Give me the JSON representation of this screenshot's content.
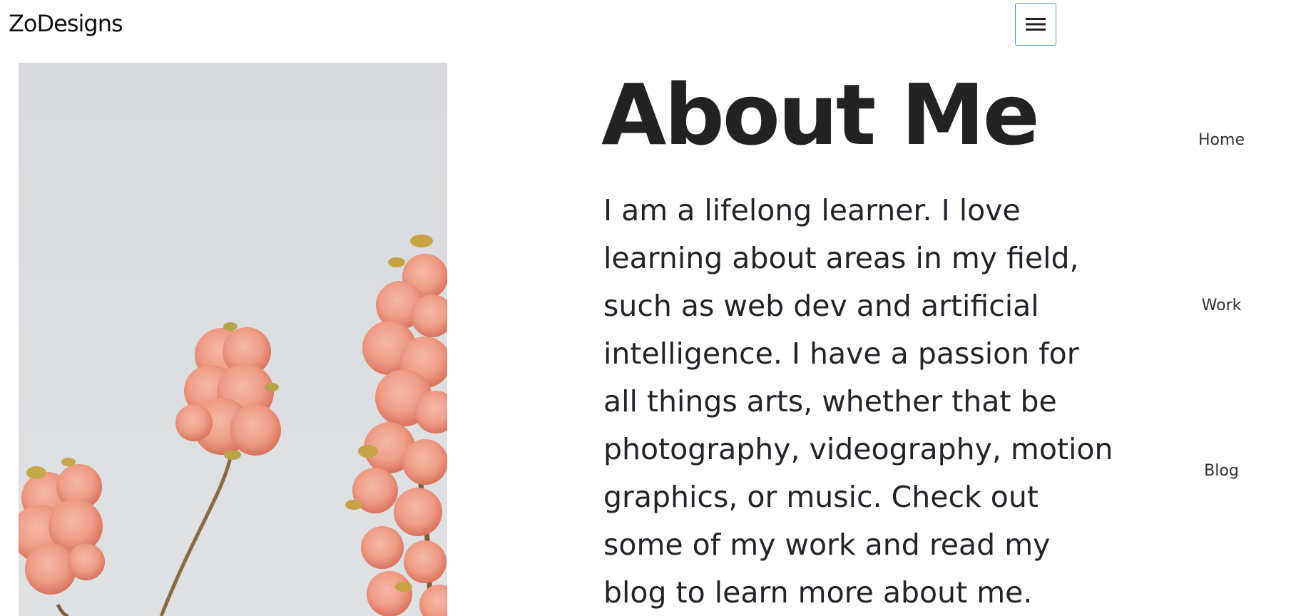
{
  "header": {
    "brand": "ZoDesigns",
    "toggler_icon": "menu-icon"
  },
  "hero": {
    "image_subject": "pink blossom photo",
    "title": "About Me",
    "bio": "I am a lifelong learner. I love learning about areas in my field, such as web dev and artificial intelligence. I have a passion for all things arts, whether that be photography, videography, motion graphics, or music. Check out some of my work and read my blog to learn more about me."
  },
  "nav": {
    "items": [
      {
        "label": "Home"
      },
      {
        "label": "Work"
      },
      {
        "label": "Blog"
      }
    ]
  },
  "colors": {
    "toggler_border": "#4a90e2",
    "text": "#212529",
    "sky": "#dcdfe2",
    "blossom": "#f2a08c"
  }
}
